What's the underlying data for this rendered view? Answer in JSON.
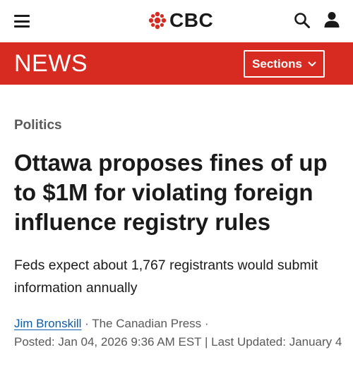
{
  "header": {
    "brand": "CBC",
    "menu_icon": "hamburger-menu-icon",
    "search_icon": "search-icon",
    "user_icon": "user-account-icon",
    "logo_color": "#d72a20"
  },
  "news_bar": {
    "label": "NEWS",
    "sections_label": "Sections",
    "background": "#d72a20"
  },
  "article": {
    "category": "Politics",
    "headline": "Ottawa proposes fines of up to $1M for violating foreign influence registry rules",
    "deck": "Feds expect about 1,767 registrants would submit information annually",
    "author": "Jim Bronskill",
    "source": " · The Canadian Press ·",
    "posted": "Posted: Jan 04, 2026 9:36 AM EST | Last Updated: January 4"
  }
}
